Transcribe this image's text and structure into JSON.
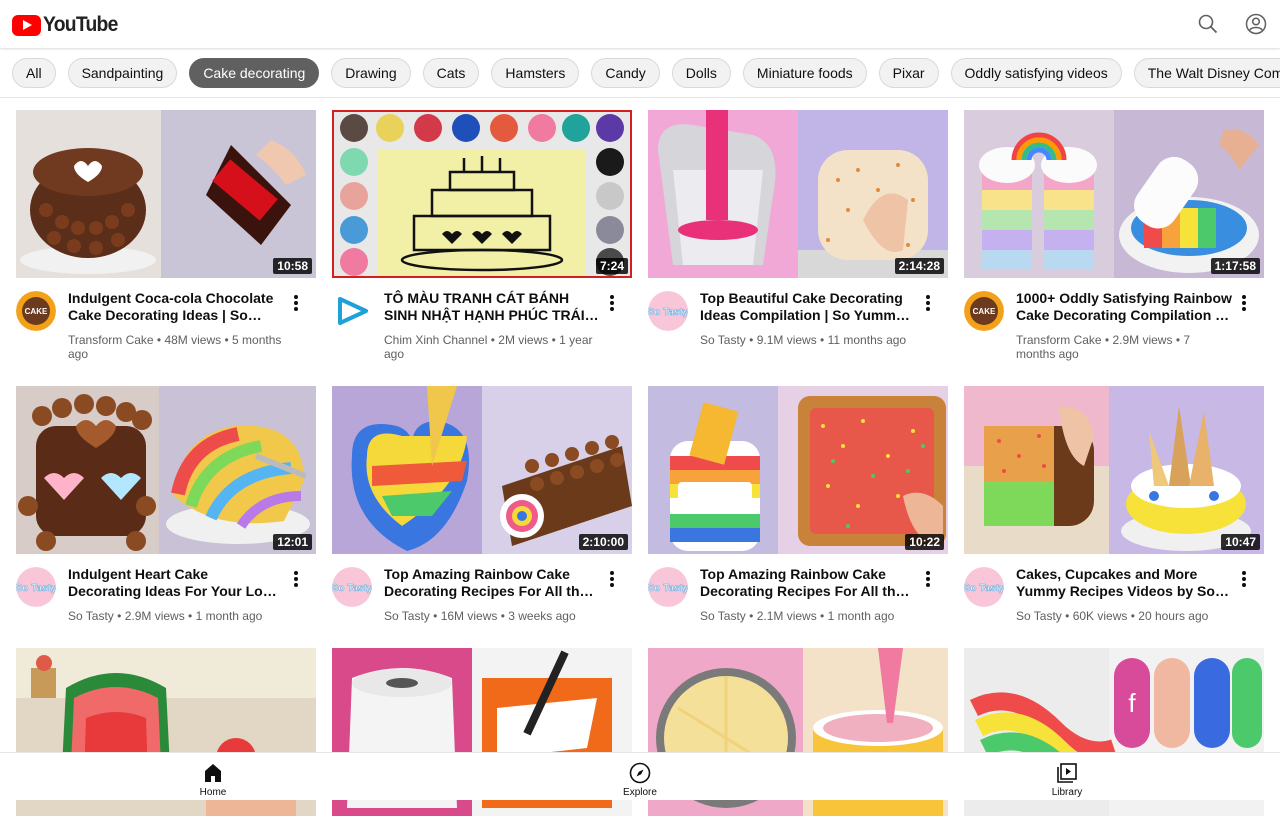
{
  "app": {
    "logo_text": "YouTube",
    "brand_color": "#ff0000"
  },
  "header": {
    "icons": [
      "search-icon",
      "account-icon"
    ]
  },
  "chips": [
    {
      "label": "All",
      "active": false
    },
    {
      "label": "Sandpainting",
      "active": false
    },
    {
      "label": "Cake decorating",
      "active": true
    },
    {
      "label": "Drawing",
      "active": false
    },
    {
      "label": "Cats",
      "active": false
    },
    {
      "label": "Hamsters",
      "active": false
    },
    {
      "label": "Candy",
      "active": false
    },
    {
      "label": "Dolls",
      "active": false
    },
    {
      "label": "Miniature foods",
      "active": false
    },
    {
      "label": "Pixar",
      "active": false
    },
    {
      "label": "Oddly satisfying videos",
      "active": false
    },
    {
      "label": "The Walt Disney Company",
      "active": false
    }
  ],
  "videos": [
    {
      "title": "Indulgent Coca-cola Chocolate Cake Decorating Ideas | So Tasty Cake Recipes",
      "channel": "Transform Cake",
      "views": "48M views",
      "age": "5 months ago",
      "duration": "10:58",
      "avatar": "transform"
    },
    {
      "title": "TÔ MÀU TRANH CÁT BÁNH SINH NHẬT HẠNH PHÚC TRÁI TIM",
      "channel": "Chim Xinh Channel",
      "views": "2M views",
      "age": "1 year ago",
      "duration": "7:24",
      "avatar": "chimxinh"
    },
    {
      "title": "Top Beautiful Cake Decorating Ideas Compilation | So Yummy Cake Recipes",
      "channel": "So Tasty",
      "views": "9.1M views",
      "age": "11 months ago",
      "duration": "2:14:28",
      "avatar": "sotasty"
    },
    {
      "title": "1000+ Oddly Satisfying Rainbow Cake Decorating Compilation | Yummy",
      "channel": "Transform Cake",
      "views": "2.9M views",
      "age": "7 months ago",
      "duration": "1:17:58",
      "avatar": "transform"
    },
    {
      "title": "Indulgent Heart Cake Decorating Ideas For Your Lover | So Tasty Cake",
      "channel": "So Tasty",
      "views": "2.9M views",
      "age": "1 month ago",
      "duration": "12:01",
      "avatar": "sotasty"
    },
    {
      "title": "Top Amazing Rainbow Cake Decorating Recipes For All the Family",
      "channel": "So Tasty",
      "views": "16M views",
      "age": "3 weeks ago",
      "duration": "2:10:00",
      "avatar": "sotasty"
    },
    {
      "title": "Top Amazing Rainbow Cake Decorating Recipes For All the Family",
      "channel": "So Tasty",
      "views": "2.1M views",
      "age": "1 month ago",
      "duration": "10:22",
      "avatar": "sotasty"
    },
    {
      "title": "Cakes, Cupcakes and More Yummy Recipes Videos by So Tasty",
      "channel": "So Tasty",
      "views": "60K views",
      "age": "20 hours ago",
      "duration": "10:47",
      "avatar": "sotasty"
    },
    {
      "title": "",
      "channel": "",
      "views": "",
      "age": "",
      "duration": "",
      "avatar": ""
    },
    {
      "title": "",
      "channel": "",
      "views": "",
      "age": "",
      "duration": "",
      "avatar": ""
    },
    {
      "title": "",
      "channel": "",
      "views": "",
      "age": "",
      "duration": "",
      "avatar": ""
    },
    {
      "title": "",
      "channel": "",
      "views": "",
      "age": "",
      "duration": "",
      "avatar": ""
    }
  ],
  "avatar_labels": {
    "transform": "CAKE",
    "sotasty": "So Tasty"
  },
  "bottom_nav": [
    {
      "label": "Home",
      "icon": "home-icon"
    },
    {
      "label": "Explore",
      "icon": "compass-icon"
    },
    {
      "label": "Library",
      "icon": "library-icon"
    }
  ]
}
